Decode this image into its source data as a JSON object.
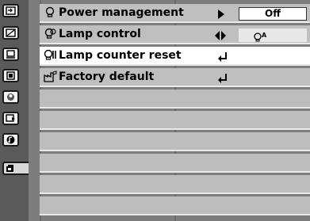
{
  "sidebar": {
    "icons": [
      {
        "name": "input-icon"
      },
      {
        "name": "picture-adjust-icon"
      },
      {
        "name": "screen-icon"
      },
      {
        "name": "image-select-icon"
      },
      {
        "name": "color-adjust-icon"
      },
      {
        "name": "pc-adjust-icon"
      },
      {
        "name": "sound-icon"
      },
      {
        "name": "setting-icon"
      }
    ]
  },
  "menu": {
    "items": [
      {
        "label": "Power management",
        "value": "Off"
      },
      {
        "label": "Lamp control",
        "value_icon": "lamp-auto-icon",
        "value_text": "A"
      },
      {
        "label": "Lamp counter reset"
      },
      {
        "label": "Factory default"
      }
    ]
  },
  "colors": {
    "row_bg": "#bfbfbf",
    "selected_bg": "#ffffff",
    "frame": "#7d7d7d"
  }
}
